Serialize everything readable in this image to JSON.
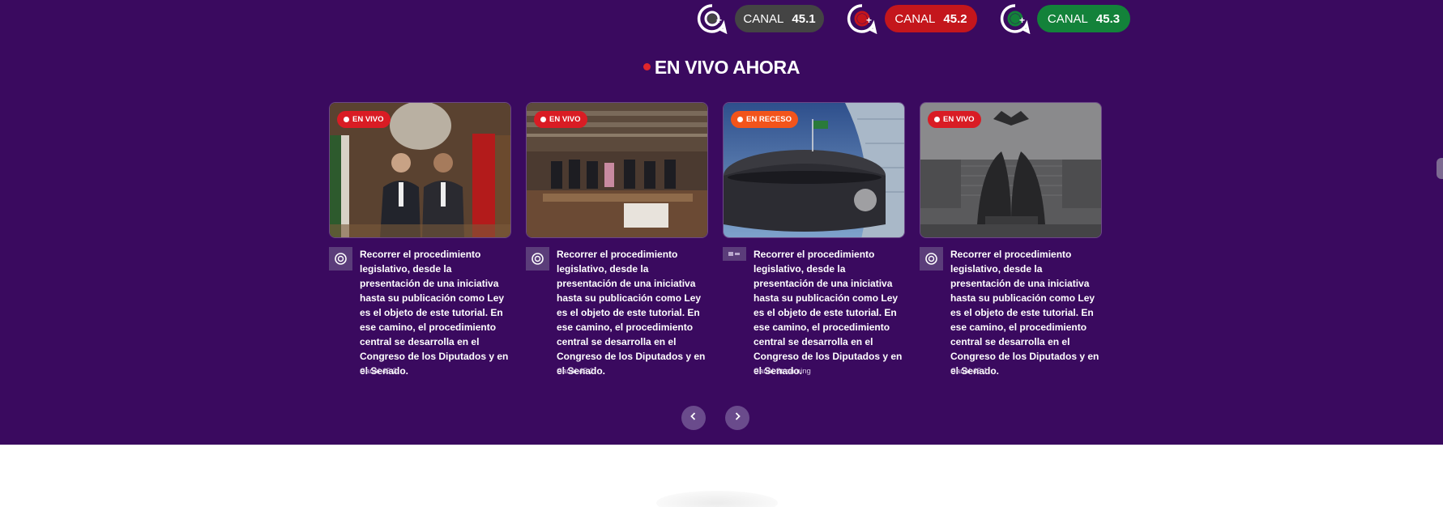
{
  "channels": [
    {
      "label": "CANAL",
      "number": "45.1",
      "color": "#444444",
      "logo_icon": "congress-channel-icon"
    },
    {
      "label": "CANAL",
      "number": "45.2",
      "color": "#c4161c",
      "logo_icon": "congress-channel-icon"
    },
    {
      "label": "CANAL",
      "number": "45.3",
      "color": "#13823a",
      "logo_icon": "congress-channel-icon"
    }
  ],
  "section_title": "EN VIVO AHORA",
  "cards": [
    {
      "status": "EN VIVO",
      "status_type": "live",
      "description": "Recorrer el procedimiento legislativo, desde la presentación de una iniciativa hasta su publicación como Ley es el objeto de este tutorial. En ese camino, el procedimiento central se desarrolla en el Congreso de los Diputados y en el Senado.",
      "source": "Canal 45.3",
      "image": "officials-photo"
    },
    {
      "status": "EN VIVO",
      "status_type": "live",
      "description": "Recorrer el procedimiento legislativo, desde la presentación de una iniciativa hasta su publicación como Ley es el objeto de este tutorial. En ese camino, el procedimiento central se desarrolla en el Congreso de los Diputados y en el Senado.",
      "source": "Canal 45.2",
      "image": "chamber-session-photo"
    },
    {
      "status": "EN RECESO",
      "status_type": "recess",
      "description": "Recorrer el procedimiento legislativo, desde la presentación de una iniciativa hasta su publicación como Ley es el objeto de este tutorial. En ese camino, el procedimiento central se desarrolla en el Congreso de los Diputados y en el Senado.",
      "source": "Canal Streaming",
      "image": "senate-building-photo"
    },
    {
      "status": "EN VIVO",
      "status_type": "live",
      "description": "Recorrer el procedimiento legislativo, desde la presentación de una iniciativa hasta su publicación como Ley es el objeto de este tutorial. En ese camino, el procedimiento central se desarrolla en el Congreso de los Diputados y en el Senado.",
      "source": "Canal 45.1",
      "image": "monument-photo"
    }
  ],
  "pager": {
    "prev_icon": "chevron-left-icon",
    "next_icon": "chevron-right-icon"
  }
}
